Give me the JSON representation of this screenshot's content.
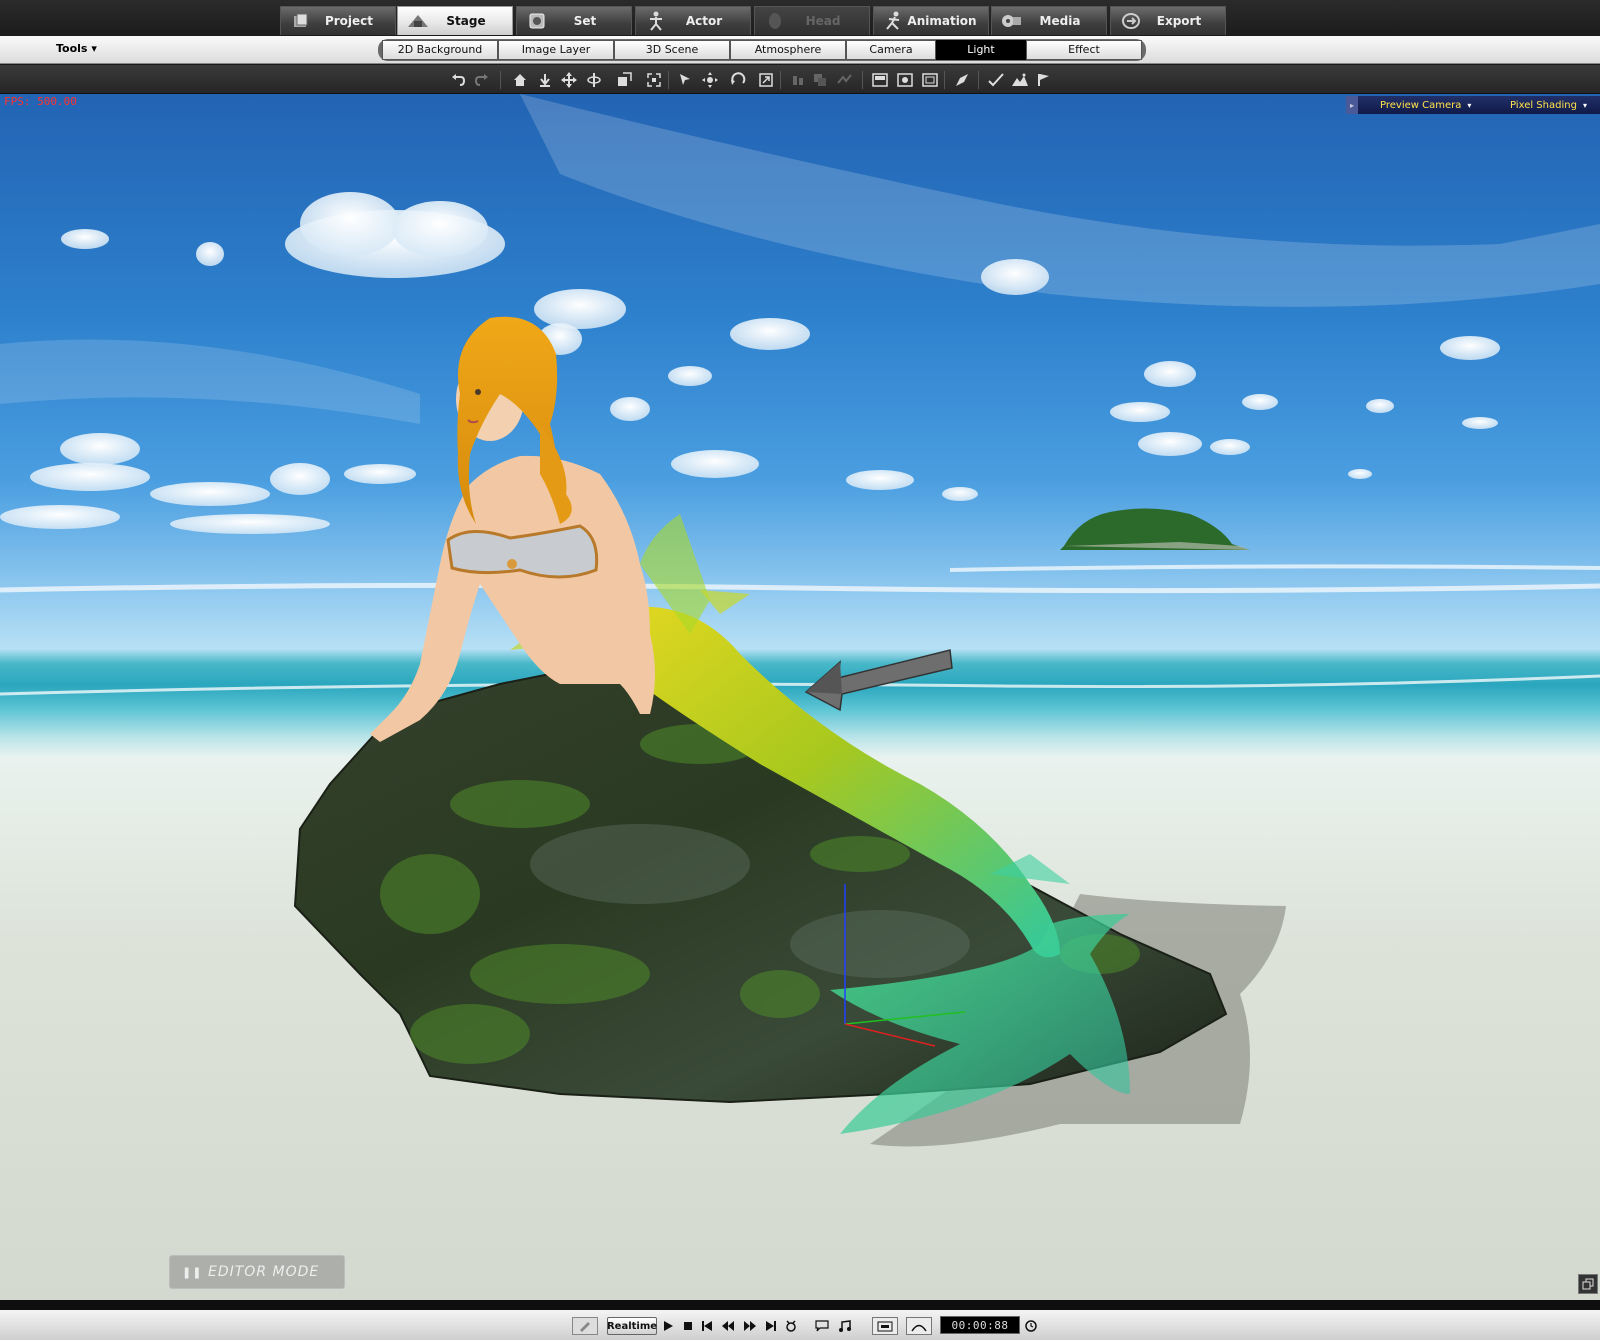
{
  "main_tabs": [
    {
      "label": "Project",
      "icon": "project-icon",
      "state": "normal"
    },
    {
      "label": "Stage",
      "icon": "stage-icon",
      "state": "active"
    },
    {
      "label": "Set",
      "icon": "set-icon",
      "state": "normal"
    },
    {
      "label": "Actor",
      "icon": "actor-icon",
      "state": "normal"
    },
    {
      "label": "Head",
      "icon": "head-icon",
      "state": "disabled"
    },
    {
      "label": "Animation",
      "icon": "animation-icon",
      "state": "normal"
    },
    {
      "label": "Media",
      "icon": "media-icon",
      "state": "normal"
    },
    {
      "label": "Export",
      "icon": "export-icon",
      "state": "normal"
    }
  ],
  "tools_menu": {
    "label": "Tools"
  },
  "sub_tabs": [
    {
      "label": "2D Background",
      "active": false
    },
    {
      "label": "Image Layer",
      "active": false
    },
    {
      "label": "3D Scene",
      "active": false
    },
    {
      "label": "Atmosphere",
      "active": false
    },
    {
      "label": "Camera",
      "active": false
    },
    {
      "label": "Light",
      "active": true
    },
    {
      "label": "Effect",
      "active": false
    }
  ],
  "toolbar_icons": [
    "undo-icon",
    "redo-icon",
    "home-icon",
    "drop-to-ground-icon",
    "move-icon",
    "rotate-icon",
    "scale-icon",
    "fit-icon",
    "select-icon",
    "pan-icon",
    "orbit-icon",
    "zoom-icon",
    "align-icon",
    "copy-icon",
    "link-icon",
    "view-single-icon",
    "view-camera-icon",
    "view-quad-icon",
    "paint-icon",
    "check-icon",
    "terrain-icon",
    "flag-icon"
  ],
  "viewport": {
    "fps_label": "FPS: 500.00",
    "camera_label": "Preview Camera",
    "shading_label": "Pixel Shading",
    "editor_mode_label": "EDITOR MODE"
  },
  "bottom_bar": {
    "realtime_label": "Realtime",
    "timecode": "00:00:88"
  },
  "colors": {
    "accent_yellow": "#ffe24a",
    "fps_red": "#ff3030",
    "active_tab_bg": "#ffffff",
    "active_subtab_bg": "#000000"
  }
}
